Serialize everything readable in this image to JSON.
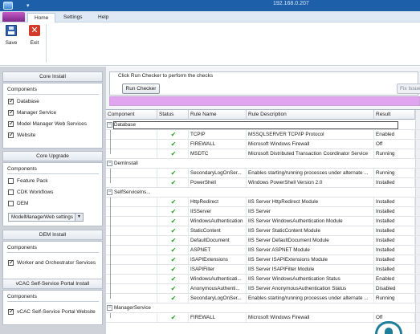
{
  "titlebar": {
    "address": "192.168.0.207"
  },
  "ribbon": {
    "tabs": [
      {
        "label": "Home",
        "active": true
      },
      {
        "label": "Settings",
        "active": false
      },
      {
        "label": "Help",
        "active": false
      }
    ],
    "save_label": "Save",
    "exit_label": "Exit"
  },
  "left": {
    "core_install": {
      "header": "Core Install",
      "caption": "Components",
      "items": [
        {
          "label": "Database",
          "checked": true
        },
        {
          "label": "Manager Service",
          "checked": true
        },
        {
          "label": "Model Manager Web Services",
          "checked": true
        },
        {
          "label": "Website",
          "checked": true
        }
      ]
    },
    "core_upgrade": {
      "header": "Core Upgrade",
      "caption": "Components",
      "items": [
        {
          "label": "Feature Pack",
          "checked": false
        },
        {
          "label": "CDK Workflows",
          "checked": false
        },
        {
          "label": "DEM",
          "checked": false
        }
      ],
      "dropdown_value": "ModelManagerWeb settings"
    },
    "dem_install": {
      "header": "DEM Install",
      "caption": "Components",
      "items": [
        {
          "label": "Worker and Orchestrator Services",
          "checked": true
        }
      ]
    },
    "portal_install": {
      "header": "vCAC Self-Service Portal Install",
      "caption": "Components",
      "items": [
        {
          "label": "vCAC Self-Service Portal Website",
          "checked": true
        }
      ]
    }
  },
  "checks": {
    "legend": "Click Run Checker to perform the checks",
    "run_button": "Run Checker",
    "fix_button": "Fix Issue"
  },
  "grid": {
    "columns": [
      "Component",
      "Status",
      "Rule Name",
      "Rule Description",
      "Result"
    ],
    "groups": [
      {
        "name": "Database",
        "rows": [
          {
            "rule": "TCPIP",
            "desc": "MSSQLSERVER TCP/IP Protocol",
            "result": "Enabled"
          },
          {
            "rule": "FIREWALL",
            "desc": "Microsoft Windows Firewall",
            "result": "Off"
          },
          {
            "rule": "MSDTC",
            "desc": "Microsoft Distributed Transaction Coordinator Service",
            "result": "Running"
          }
        ]
      },
      {
        "name": "DemInstall",
        "rows": [
          {
            "rule": "SecondaryLogOnSer...",
            "desc": "Enables starting/running processes under alternate ...",
            "result": "Running"
          },
          {
            "rule": "PowerShell",
            "desc": "Windows PowerShell Version 2.0",
            "result": "Installed"
          }
        ]
      },
      {
        "name": "SelfServiceIns...",
        "rows": [
          {
            "rule": "HttpRedirect",
            "desc": "IIS Server HttpRedirect Module",
            "result": "Installed"
          },
          {
            "rule": "IISServer",
            "desc": "IIS Server",
            "result": "Installed"
          },
          {
            "rule": "WindowsAuthentication",
            "desc": "IIS Server WindowsAuthentication Module",
            "result": "Installed"
          },
          {
            "rule": "StaticContent",
            "desc": "IIS Server StaticContent Module",
            "result": "Installed"
          },
          {
            "rule": "DefaultDocument",
            "desc": "IIS Server DefaultDocument Module",
            "result": "Installed"
          },
          {
            "rule": "ASPNET",
            "desc": "IIS Server ASPNET Module",
            "result": "Installed"
          },
          {
            "rule": "ISAPIExtensions",
            "desc": "IIS Server ISAPIExtensions Module",
            "result": "Installed"
          },
          {
            "rule": "ISAPIFilter",
            "desc": "IIS Server ISAPIFilter Module",
            "result": "Installed"
          },
          {
            "rule": "WindowsAuthenticati...",
            "desc": "IIS Server WindowsAuthentication Status",
            "result": "Enabled"
          },
          {
            "rule": "AnonymousAuthenti...",
            "desc": "IIS Server AnonymousAuthentication Status",
            "result": "Disabled"
          },
          {
            "rule": "SecondaryLogOnSer...",
            "desc": "Enables starting/running processes under alternate ...",
            "result": "Running"
          }
        ]
      },
      {
        "name": "ManagerService",
        "rows": [
          {
            "rule": "FIREWALL",
            "desc": "Microsoft Windows Firewall",
            "result": "Off"
          }
        ]
      }
    ]
  }
}
